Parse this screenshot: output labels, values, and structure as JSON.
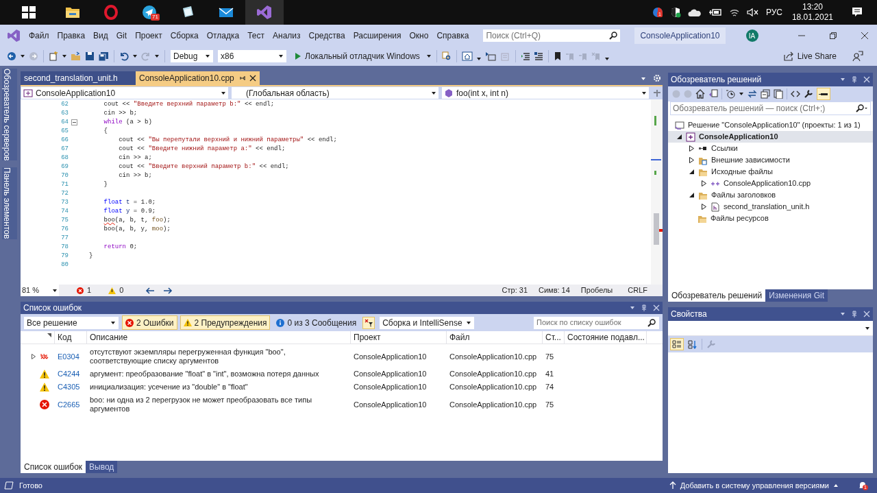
{
  "taskbar": {
    "apps": [
      {
        "selected": false
      },
      {
        "selected": false
      },
      {
        "selected": false,
        "badge": "71"
      },
      {
        "selected": false
      },
      {
        "selected": false
      },
      {
        "selected": true
      }
    ],
    "tray": {
      "badge": "1",
      "language": "РУС",
      "time": "13:20",
      "date": "18.01.2021"
    }
  },
  "menu": {
    "items": [
      "Файл",
      "Правка",
      "Вид",
      "Git",
      "Проект",
      "Сборка",
      "Отладка",
      "Тест",
      "Анализ",
      "Средства",
      "Расширения",
      "Окно",
      "Справка"
    ],
    "search_placeholder": "Поиск (Ctrl+Q)",
    "solution_name": "ConsoleApplication10",
    "avatar": "IA"
  },
  "toolbar": {
    "configuration": "Debug",
    "platform": "x86",
    "start": "Локальный отладчик Windows",
    "live_share": "Live Share"
  },
  "side_tabs": [
    "Обозреватель серверов",
    "Панель элементов"
  ],
  "editor": {
    "tabs": [
      {
        "label": "second_translation_unit.h",
        "selected": false
      },
      {
        "label": "ConsoleApplication10.cpp",
        "selected": true
      }
    ],
    "nav": [
      "ConsoleApplication10",
      "(Глобальная область)",
      "foo(int x, int n)"
    ],
    "lines": [
      {
        "number": "62",
        "fold": false,
        "tokens": [
          {
            "kind": "plain",
            "text": "    cout << "
          },
          {
            "kind": "string",
            "text": "\"Введите верхний параметр b:\""
          },
          {
            "kind": "plain",
            "text": " << endl;"
          }
        ]
      },
      {
        "number": "63",
        "fold": false,
        "tokens": [
          {
            "kind": "plain",
            "text": "    cin >> b;"
          }
        ]
      },
      {
        "number": "64",
        "fold": true,
        "tokens": [
          {
            "kind": "control",
            "text": "    while"
          },
          {
            "kind": "plain",
            "text": " (a > b)"
          }
        ]
      },
      {
        "number": "65",
        "fold": false,
        "tokens": [
          {
            "kind": "plain",
            "text": "    {"
          }
        ]
      },
      {
        "number": "66",
        "fold": false,
        "tokens": [
          {
            "kind": "plain",
            "text": "        cout << "
          },
          {
            "kind": "string",
            "text": "\"Вы перепутали верхний и нижний параметры\""
          },
          {
            "kind": "plain",
            "text": " << endl;"
          }
        ]
      },
      {
        "number": "67",
        "fold": false,
        "tokens": [
          {
            "kind": "plain",
            "text": "        cout << "
          },
          {
            "kind": "string",
            "text": "\"Введите нижний параметр a:\""
          },
          {
            "kind": "plain",
            "text": " << endl;"
          }
        ]
      },
      {
        "number": "68",
        "fold": false,
        "tokens": [
          {
            "kind": "plain",
            "text": "        cin >> a;"
          }
        ]
      },
      {
        "number": "69",
        "fold": false,
        "tokens": [
          {
            "kind": "plain",
            "text": "        cout << "
          },
          {
            "kind": "string",
            "text": "\"Введите верхний параметр b:\""
          },
          {
            "kind": "plain",
            "text": " << endl;"
          }
        ]
      },
      {
        "number": "70",
        "fold": false,
        "tokens": [
          {
            "kind": "plain",
            "text": "        cin >> b;"
          }
        ]
      },
      {
        "number": "71",
        "fold": false,
        "tokens": [
          {
            "kind": "plain",
            "text": "    }"
          }
        ]
      },
      {
        "number": "72",
        "fold": false
      },
      {
        "number": "73",
        "fold": false,
        "tokens": [
          {
            "kind": "keyword",
            "text": "    float"
          },
          {
            "kind": "variable",
            "text": " t"
          },
          {
            "kind": "plain",
            "text": " = 1.0;"
          }
        ]
      },
      {
        "number": "74",
        "fold": false,
        "tokens": [
          {
            "kind": "keyword",
            "text": "    float"
          },
          {
            "kind": "variable",
            "text": " y"
          },
          {
            "kind": "plain",
            "text": " = 0.9;"
          }
        ]
      },
      {
        "number": "75",
        "fold": false,
        "tokens": [
          {
            "kind": "error",
            "text": "    boo"
          },
          {
            "kind": "plain",
            "text": "(a, b, t, "
          },
          {
            "kind": "function",
            "text": "foo"
          },
          {
            "kind": "plain",
            "text": ");"
          }
        ]
      },
      {
        "number": "76",
        "fold": false,
        "tokens": [
          {
            "kind": "plain",
            "text": "    boo(a, b, y, "
          },
          {
            "kind": "function",
            "text": "moo"
          },
          {
            "kind": "plain",
            "text": ");"
          }
        ]
      },
      {
        "number": "77",
        "fold": false
      },
      {
        "number": "78",
        "fold": false,
        "tokens": [
          {
            "kind": "control",
            "text": "    return"
          },
          {
            "kind": "plain",
            "text": " 0;"
          }
        ]
      },
      {
        "number": "79",
        "fold": false,
        "tokens": [
          {
            "kind": "plain",
            "text": "}"
          }
        ]
      },
      {
        "number": "80",
        "fold": false
      }
    ],
    "status": {
      "zoom": "81 %",
      "errors": "1",
      "warnings": "0",
      "line": "Стр: 31",
      "column": "Симв: 14",
      "whitespace": "Пробелы",
      "eol": "CRLF"
    }
  },
  "error_list": {
    "title": "Список ошибок",
    "scope": "Все решение",
    "filters": [
      {
        "kind": "error",
        "label": "2 Ошибки",
        "selected": true
      },
      {
        "kind": "warning",
        "label": "2 Предупреждения",
        "selected": true
      },
      {
        "kind": "info",
        "label": "0 из 3 Сообщения",
        "selected": false
      }
    ],
    "source": "Сборка и IntelliSense",
    "search_placeholder": "Поиск по списку ошибок",
    "columns": [
      "Код",
      "Описание",
      "Проект",
      "Файл",
      "Ст...",
      "Состояние подавл..."
    ],
    "rows": [
      {
        "kind": "intellisense",
        "expandable": true,
        "code": "E0304",
        "description": "отсутствуют экземпляры перегруженная функция \"boo\", соответствующие списку аргументов",
        "project": "ConsoleApplication10",
        "file": "ConsoleApplication10.cpp",
        "line": "75"
      },
      {
        "kind": "warning",
        "expandable": false,
        "code": "C4244",
        "description": "аргумент: преобразование \"float\" в \"int\", возможна потеря данных",
        "project": "ConsoleApplication10",
        "file": "ConsoleApplication10.cpp",
        "line": "41"
      },
      {
        "kind": "warning",
        "expandable": false,
        "code": "C4305",
        "description": "инициализация: усечение из \"double\" в \"float\"",
        "project": "ConsoleApplication10",
        "file": "ConsoleApplication10.cpp",
        "line": "74"
      },
      {
        "kind": "error",
        "expandable": false,
        "code": "C2665",
        "description": "boo: ни одна из 2 перегрузок не может преобразовать все типы аргументов",
        "project": "ConsoleApplication10",
        "file": "ConsoleApplication10.cpp",
        "line": "75"
      }
    ],
    "tabs": [
      {
        "label": "Список ошибок",
        "selected": true
      },
      {
        "label": "Вывод",
        "selected": false
      }
    ]
  },
  "solution_explorer": {
    "title": "Обозреватель решений",
    "search_placeholder": "Обозреватель решений — поиск (Ctrl+;)",
    "tree": [
      {
        "kind": "solution",
        "label": "Решение \"ConsoleApplication10\" (проекты: 1 из 1)",
        "selected": false,
        "children": [
          {
            "kind": "project",
            "label": "ConsoleApplication10",
            "expanded": true,
            "selected": true,
            "children": [
              {
                "kind": "references",
                "label": "Ссылки",
                "expanded": false,
                "selected": false
              },
              {
                "kind": "external",
                "label": "Внешние зависимости",
                "expanded": false,
                "selected": false
              },
              {
                "kind": "folder",
                "label": "Исходные файлы",
                "expanded": true,
                "selected": false,
                "children": [
                  {
                    "kind": "cpp",
                    "label": "ConsoleApplication10.cpp",
                    "expanded": false,
                    "selected": false
                  }
                ]
              },
              {
                "kind": "folder",
                "label": "Файлы заголовков",
                "expanded": true,
                "selected": false,
                "children": [
                  {
                    "kind": "header",
                    "label": "second_translation_unit.h",
                    "expanded": false,
                    "selected": false
                  }
                ]
              },
              {
                "kind": "folder",
                "label": "Файлы ресурсов",
                "selected": false
              }
            ]
          }
        ]
      }
    ],
    "tabs": [
      {
        "label": "Обозреватель решений",
        "selected": true
      },
      {
        "label": "Изменения Git",
        "selected": false
      }
    ]
  },
  "properties": {
    "title": "Свойства"
  },
  "status_bar": {
    "message": "Готово",
    "source_control": "Добавить в систему управления версиями",
    "badge": "1"
  }
}
